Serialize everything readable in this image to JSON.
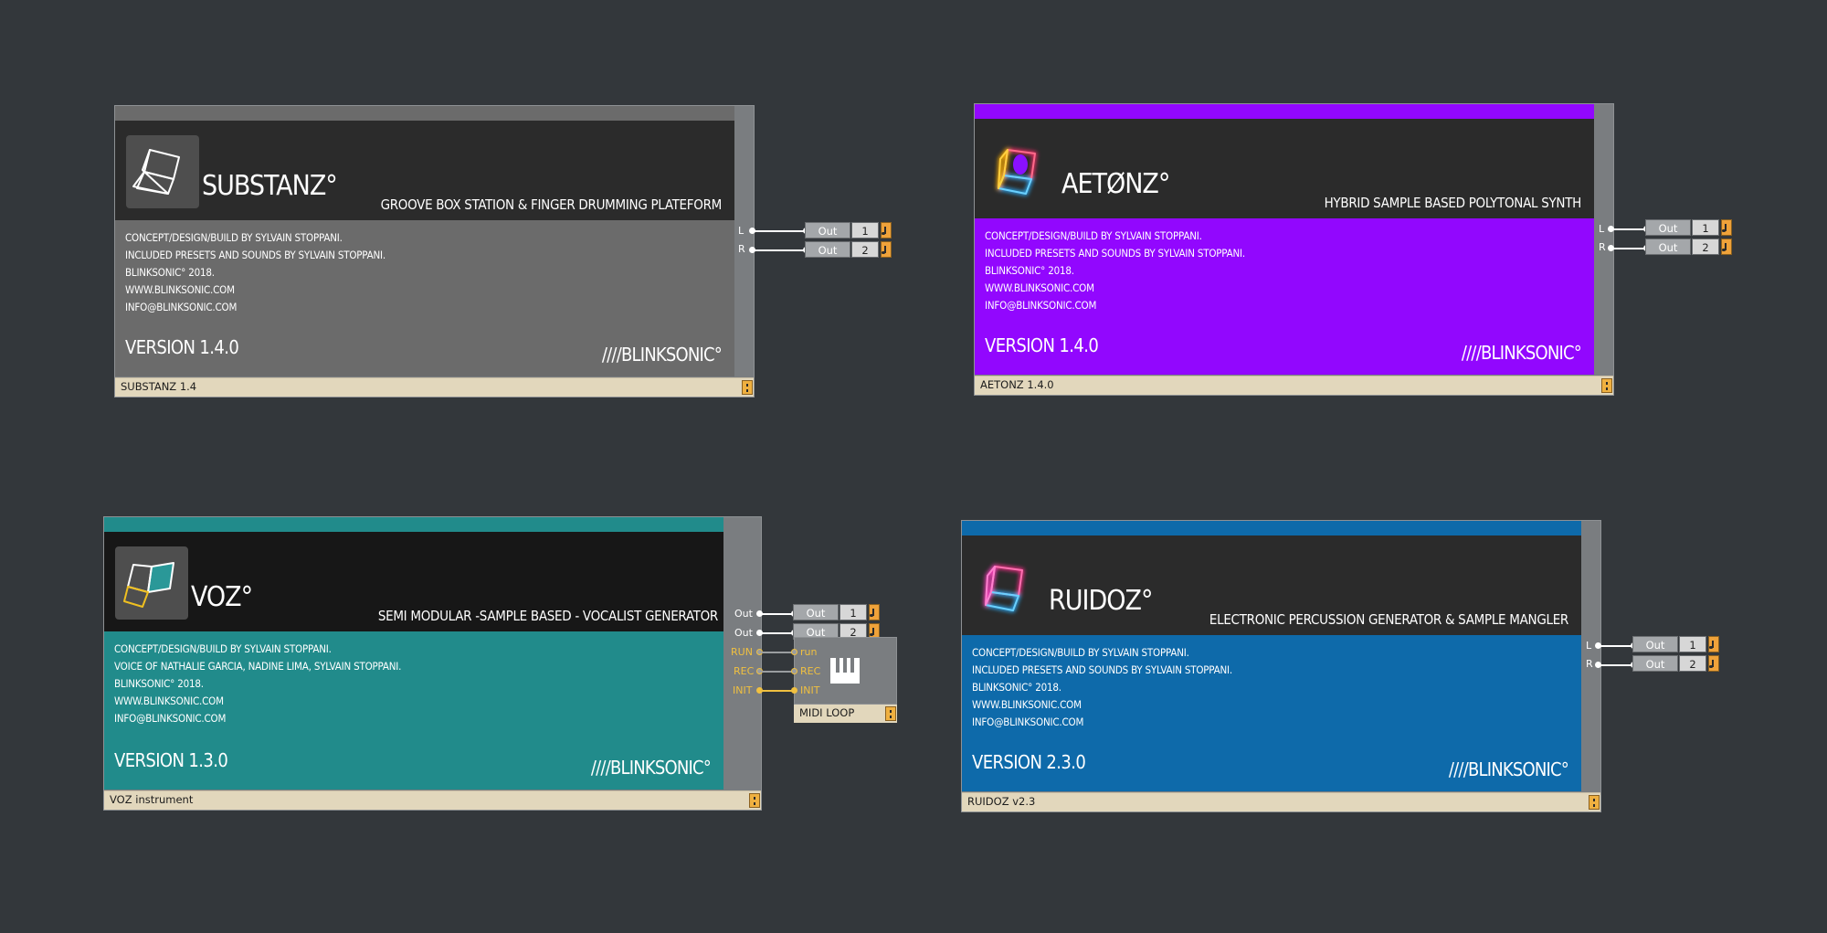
{
  "modules": [
    {
      "id": "substanz",
      "name": "SUBSTANZ°",
      "tagline": "GROOVE BOX STATION & FINGER DRUMMING PLATEFORM",
      "credits": [
        "CONCEPT/DESIGN/BUILD BY SYLVAIN STOPPANI.",
        "INCLUDED PRESETS AND SOUNDS BY SYLVAIN STOPPANI.",
        "BLINKSONIC° 2018.",
        "WWW.BLINKSONIC.COM",
        "INFO@BLINKSONIC.COM"
      ],
      "version": "VERSION 1.4.0",
      "brand": "////BLINKSONIC°",
      "footer": "SUBSTANZ 1.4",
      "color": "#6b6b6b",
      "ports": [
        "L",
        "R"
      ],
      "outputs": [
        {
          "label": "Out",
          "num": "1"
        },
        {
          "label": "Out",
          "num": "2"
        }
      ]
    },
    {
      "id": "aetonz",
      "name": "AETØNZ°",
      "tagline": "HYBRID SAMPLE BASED POLYTONAL SYNTH",
      "credits": [
        "CONCEPT/DESIGN/BUILD BY SYLVAIN STOPPANI.",
        "INCLUDED PRESETS AND SOUNDS BY SYLVAIN STOPPANI.",
        "BLINKSONIC° 2018.",
        "WWW.BLINKSONIC.COM",
        "INFO@BLINKSONIC.COM"
      ],
      "version": "VERSION 1.4.0",
      "brand": "////BLINKSONIC°",
      "footer": "AETONZ 1.4.0",
      "color": "#9207fe",
      "ports": [
        "L",
        "R"
      ],
      "outputs": [
        {
          "label": "Out",
          "num": "1"
        },
        {
          "label": "Out",
          "num": "2"
        }
      ]
    },
    {
      "id": "voz",
      "name": "VOZ°",
      "tagline": "SEMI MODULAR  -SAMPLE BASED - VOCALIST GENERATOR",
      "credits": [
        "CONCEPT/DESIGN/BUILD BY SYLVAIN STOPPANI.",
        "VOICE OF NATHALIE GARCIA, NADINE LIMA, SYLVAIN STOPPANI.",
        "BLINKSONIC° 2018.",
        "WWW.BLINKSONIC.COM",
        "INFO@BLINKSONIC.COM"
      ],
      "version": "VERSION 1.3.0",
      "brand": "////BLINKSONIC°",
      "footer": "VOZ instrument",
      "color": "#218b8b",
      "ports": [
        "Out",
        "Out",
        "RUN",
        "REC",
        "INIT"
      ],
      "outputs": [
        {
          "label": "Out",
          "num": "1"
        },
        {
          "label": "Out",
          "num": "2"
        }
      ]
    },
    {
      "id": "ruidoz",
      "name": "RUIDOZ°",
      "tagline": "ELECTRONIC PERCUSSION GENERATOR & SAMPLE MANGLER",
      "credits": [
        "CONCEPT/DESIGN/BUILD BY SYLVAIN STOPPANI.",
        "INCLUDED PRESETS AND SOUNDS BY SYLVAIN STOPPANI.",
        "BLINKSONIC° 2018.",
        "WWW.BLINKSONIC.COM",
        "INFO@BLINKSONIC.COM"
      ],
      "version": "VERSION 2.3.0",
      "brand": "////BLINKSONIC°",
      "footer": "RUIDOZ v2.3",
      "color": "#0e6aaa",
      "ports": [
        "L",
        "R"
      ],
      "outputs": [
        {
          "label": "Out",
          "num": "1"
        },
        {
          "label": "Out",
          "num": "2"
        }
      ]
    }
  ],
  "midi_loop": {
    "title": "MIDI LOOP",
    "inputs": [
      "run",
      "REC",
      "INIT"
    ],
    "port_color": "#f0c040"
  },
  "colors": {
    "background": "#33373b",
    "header": "#2b2b2b",
    "footer": "#e2d7bc",
    "accent_button": "#efa23a"
  }
}
